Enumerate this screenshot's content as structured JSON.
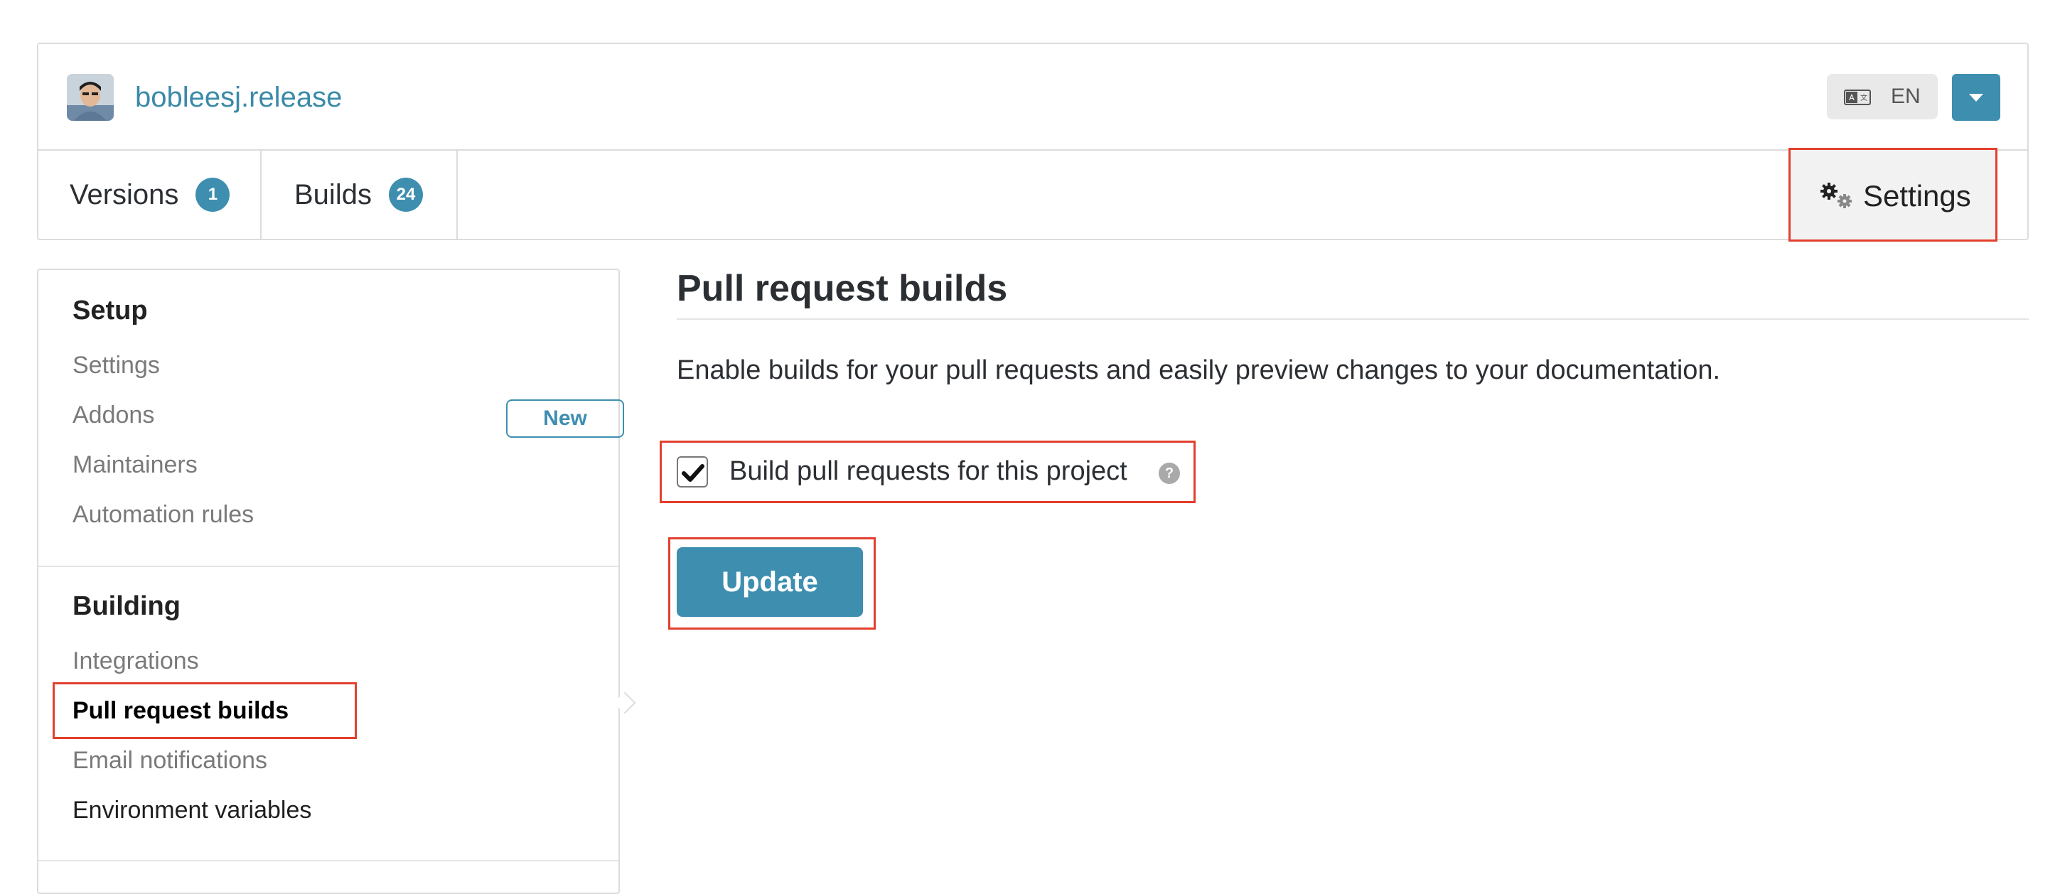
{
  "header": {
    "project_name": "bobleesj.release",
    "language": "EN"
  },
  "tabs": [
    {
      "label": "Versions",
      "count": "1"
    },
    {
      "label": "Builds",
      "count": "24"
    }
  ],
  "settings_tab": {
    "label": "Settings"
  },
  "sidebar": {
    "sections": [
      {
        "title": "Setup",
        "items": [
          "Settings",
          "Addons",
          "Maintainers",
          "Automation rules"
        ]
      },
      {
        "title": "Building",
        "items": [
          "Integrations",
          "Pull request builds",
          "Email notifications",
          "Environment variables"
        ]
      }
    ],
    "new_badge": "New"
  },
  "main": {
    "title": "Pull request builds",
    "description": "Enable builds for your pull requests and easily preview changes to your documentation.",
    "checkbox_label": "Build pull requests for this project",
    "checkbox_checked": true,
    "help_icon": "?",
    "update_button": "Update"
  },
  "colors": {
    "accent": "#3e8eb0",
    "highlight": "#e2402e"
  }
}
